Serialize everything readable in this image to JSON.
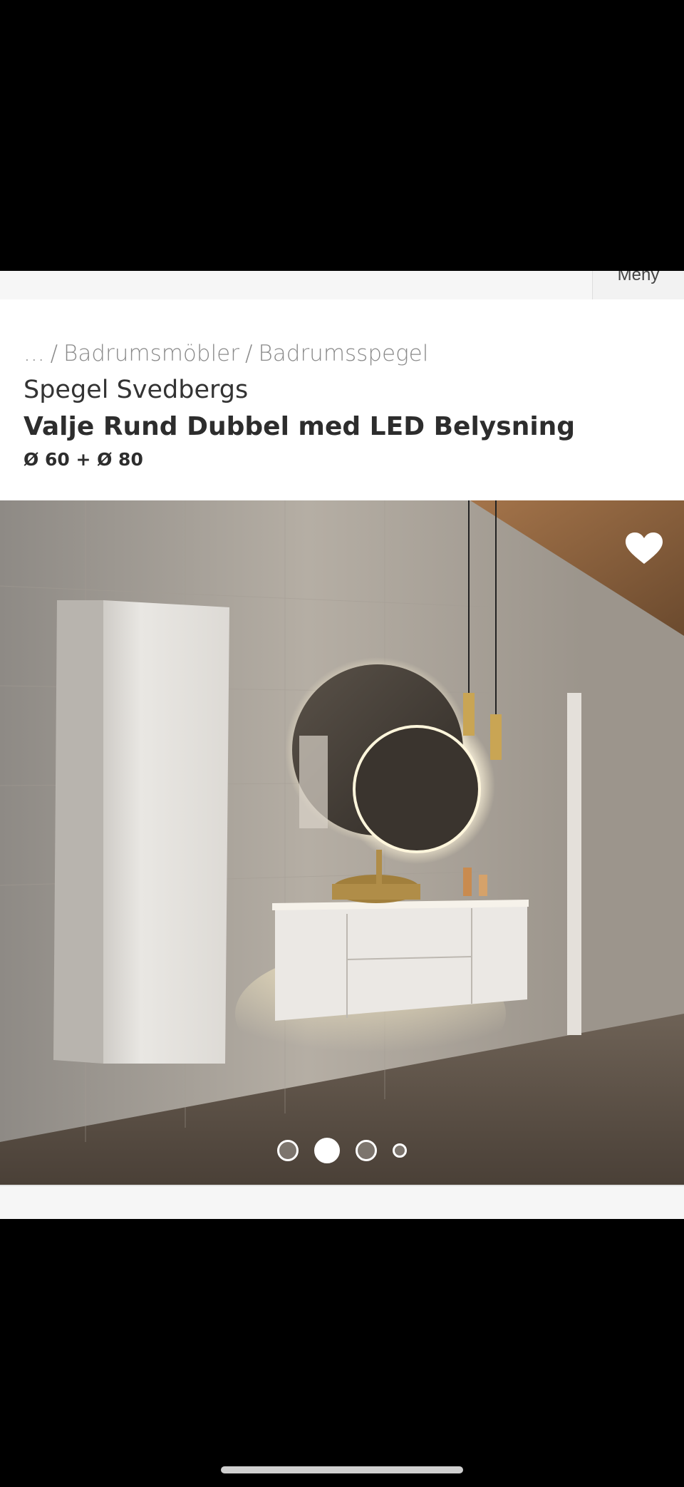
{
  "header": {
    "menu_label": "Meny"
  },
  "breadcrumb": {
    "items": [
      "...",
      "/",
      "Badrumsmöbler",
      "/",
      "Badrumsspegel"
    ]
  },
  "product": {
    "brand_line": "Spegel Svedbergs",
    "title": "Valje Rund Dubbel med LED Belysning",
    "dimensions": "Ø 60 + Ø 80"
  },
  "gallery": {
    "image_description_icon": "product-photo",
    "favorite_icon": "heart-icon",
    "slide_count": 4,
    "active_slide": 2
  },
  "colors": {
    "text_dark": "#2d2d2d",
    "text_muted": "#8a8a8a",
    "background": "#ffffff"
  }
}
